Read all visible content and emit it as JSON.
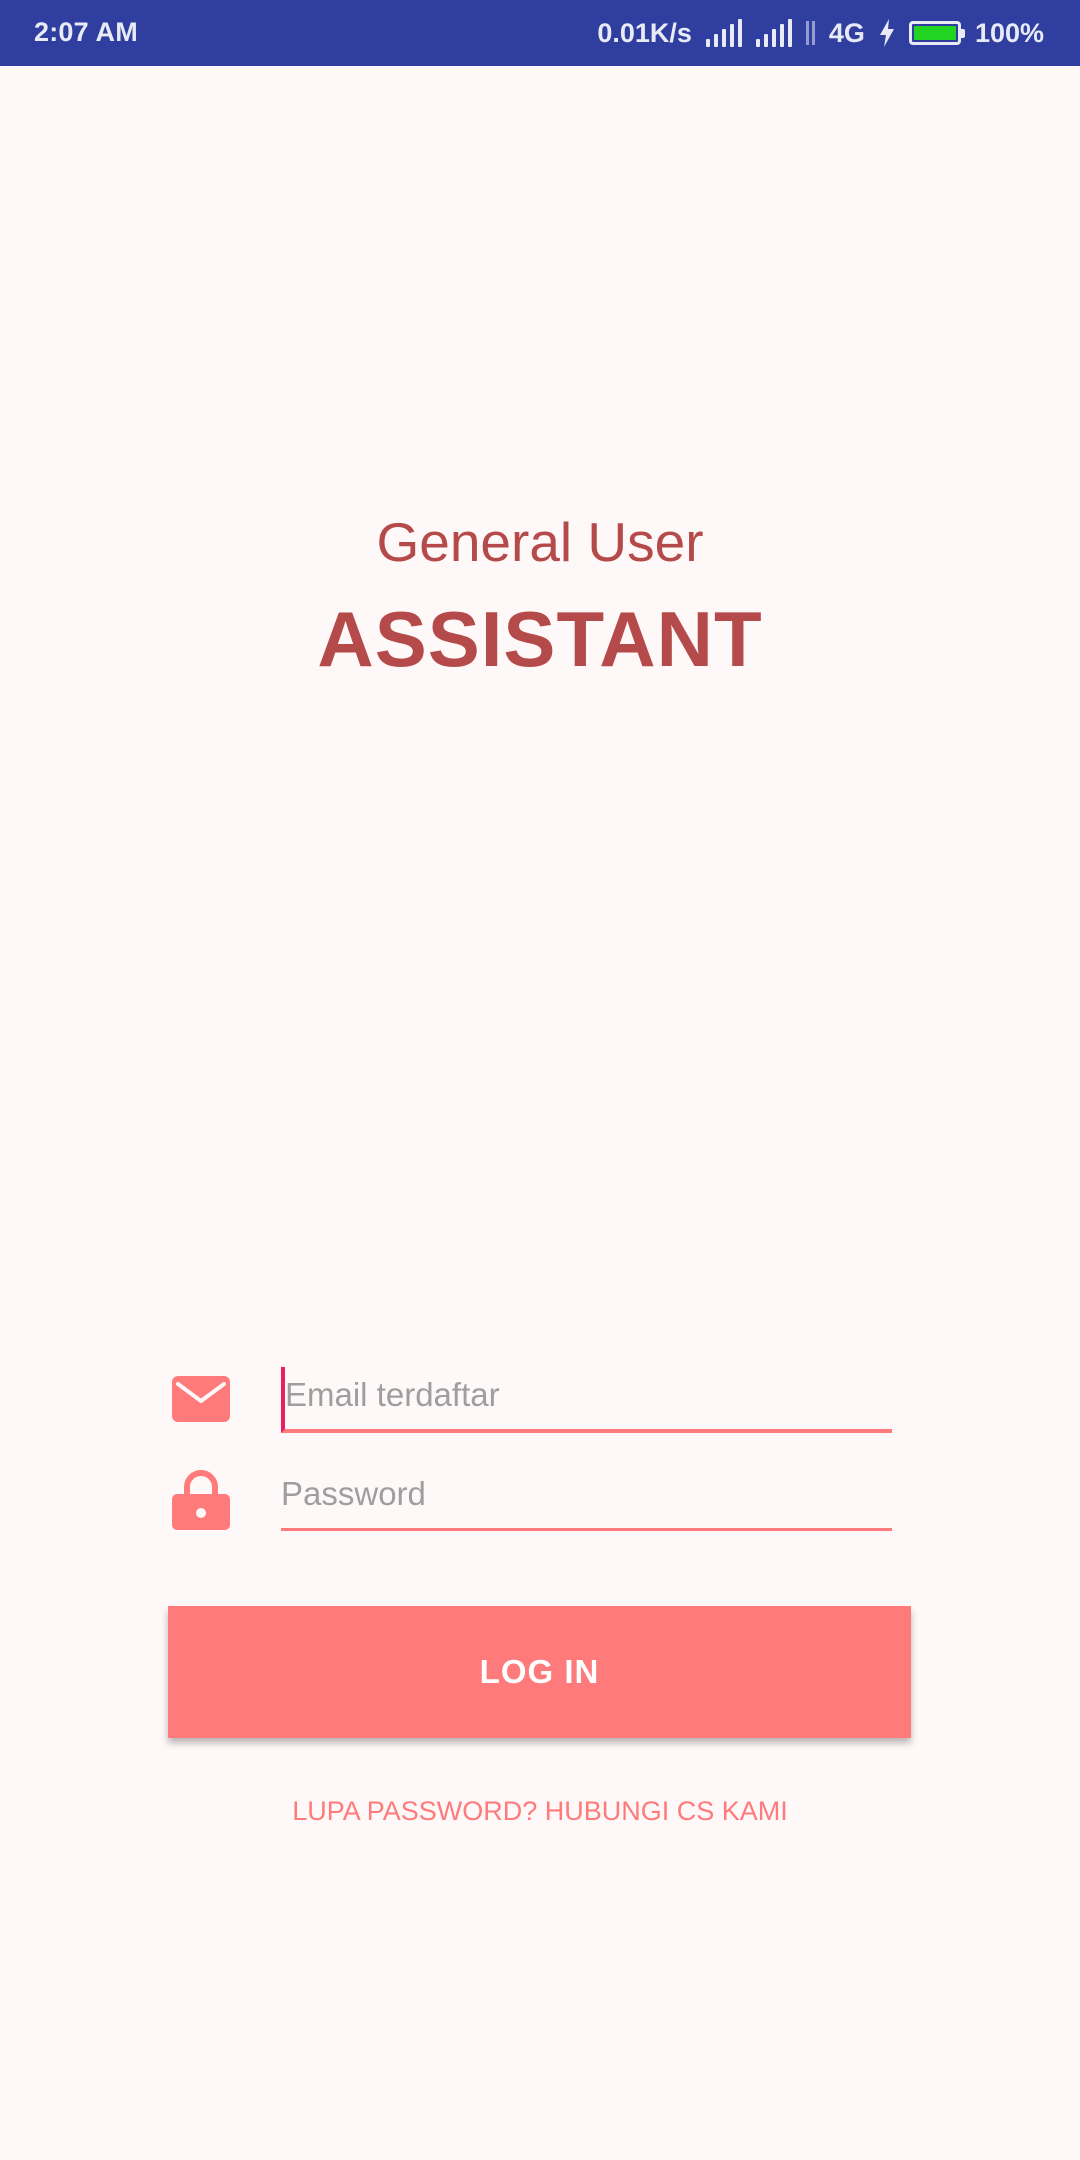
{
  "status_bar": {
    "time": "2:07 AM",
    "network_speed": "0.01K/s",
    "network_type": "4G",
    "battery": "100%",
    "battery_level": 1.0
  },
  "header": {
    "subtitle": "General User",
    "title": "ASSISTANT"
  },
  "form": {
    "email_placeholder": "Email terdaftar",
    "password_placeholder": "Password",
    "login_label": "LOG IN",
    "forgot_label": "LUPA PASSWORD? HUBUNGI CS KAMI"
  },
  "icons": {
    "email": "mail-icon",
    "password": "lock-icon"
  },
  "colors": {
    "status_bar": "#303F9F",
    "background": "#FFF8F8",
    "title": "#B54A4A",
    "accent": "#FF7A7A",
    "cursor": "#E91E63",
    "battery_fill": "#22D422"
  }
}
